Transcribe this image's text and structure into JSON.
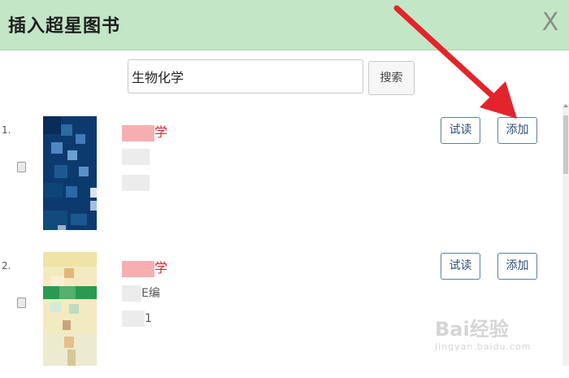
{
  "dialog": {
    "title": "插入超星图书",
    "close_label": "X"
  },
  "search": {
    "value": "生物化学",
    "button_label": "搜索"
  },
  "results": [
    {
      "index": "1.",
      "title_visible": "学",
      "line2_visible": "",
      "line3_visible": "",
      "try_label": "试读",
      "add_label": "添加"
    },
    {
      "index": "2.",
      "title_visible": "学",
      "line2_visible": "E编",
      "line3_visible": "1",
      "try_label": "试读",
      "add_label": "添加"
    }
  ],
  "watermark": {
    "top": "Bai经验",
    "bottom": "jingyan.baidu.com"
  },
  "colors": {
    "header_bg": "#c3e6c6",
    "title_red": "#d9282f",
    "button_border": "#5b7fa9",
    "arrow_red": "#e3242b"
  }
}
